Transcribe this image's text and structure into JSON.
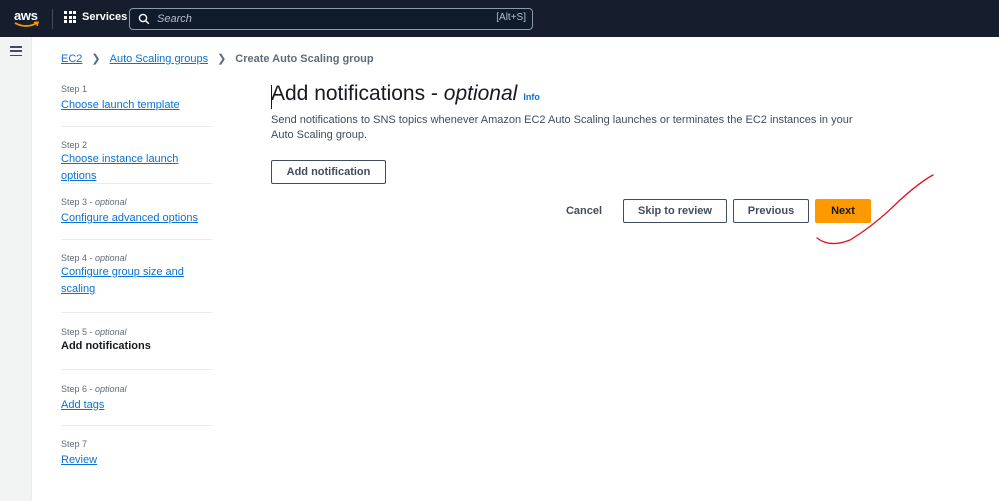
{
  "nav": {
    "logo_text": "aws",
    "services_label": "Services",
    "search_placeholder": "Search",
    "search_shortcut": "[Alt+S]"
  },
  "breadcrumb": {
    "items": [
      "EC2",
      "Auto Scaling groups"
    ],
    "current": "Create Auto Scaling group"
  },
  "steps": [
    {
      "label": "Step 1",
      "optional": "",
      "name": "Choose launch template"
    },
    {
      "label": "Step 2",
      "optional": "",
      "name": "Choose instance launch options"
    },
    {
      "label": "Step 3 - ",
      "optional": "optional",
      "name": "Configure advanced options"
    },
    {
      "label": "Step 4 - ",
      "optional": "optional",
      "name": "Configure group size and scaling"
    },
    {
      "label": "Step 5 - ",
      "optional": "optional",
      "name": "Add notifications"
    },
    {
      "label": "Step 6 - ",
      "optional": "optional",
      "name": "Add tags"
    },
    {
      "label": "Step 7",
      "optional": "",
      "name": "Review"
    }
  ],
  "main": {
    "title": "Add notifications - ",
    "title_optional": "optional",
    "info_label": "Info",
    "description": "Send notifications to SNS topics whenever Amazon EC2 Auto Scaling launches or terminates the EC2 instances in your Auto Scaling group.",
    "add_notification_label": "Add notification"
  },
  "actions": {
    "cancel": "Cancel",
    "skip": "Skip to review",
    "previous": "Previous",
    "next": "Next"
  },
  "colors": {
    "nav_bg": "#161e2d",
    "link": "#0972d3",
    "primary": "#ff9900",
    "annotation": "#e0121b"
  }
}
